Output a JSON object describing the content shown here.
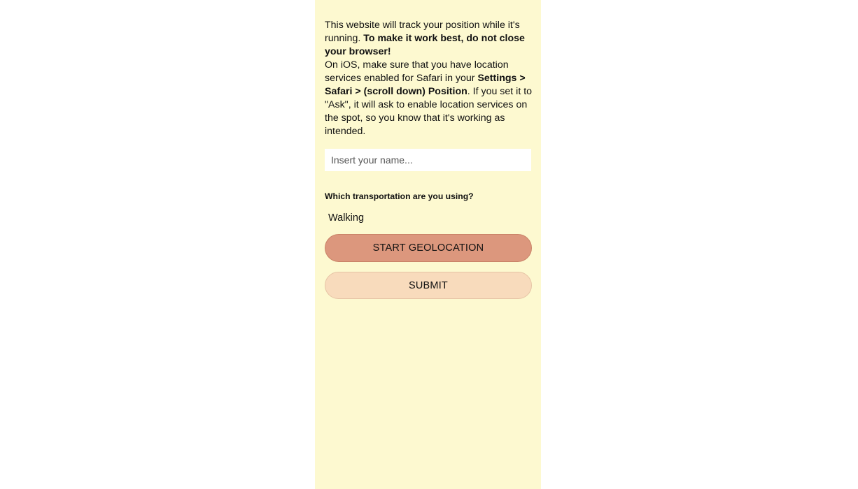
{
  "intro": {
    "line1_normal": "This website will track your position while it's running. ",
    "line1_bold": "To make it work best, do not close your browser!",
    "line2_normal_a": "On iOS, make sure that you have location services enabled for Safari in your ",
    "line2_bold": "Settings > Safari > (scroll down) Position",
    "line2_normal_b": ". If you set it to \"Ask\", it will ask to enable location services on the spot, so you know that it's working as intended."
  },
  "name_input": {
    "placeholder": "Insert your name...",
    "value": ""
  },
  "transport": {
    "label": "Which transportation are you using?",
    "selected": "Walking"
  },
  "buttons": {
    "start_label": "START GEOLOCATION",
    "submit_label": "SUBMIT"
  },
  "colors": {
    "panel_background": "#fdf9d0",
    "start_button": "#dc977d",
    "submit_button": "#f8dbbc"
  }
}
